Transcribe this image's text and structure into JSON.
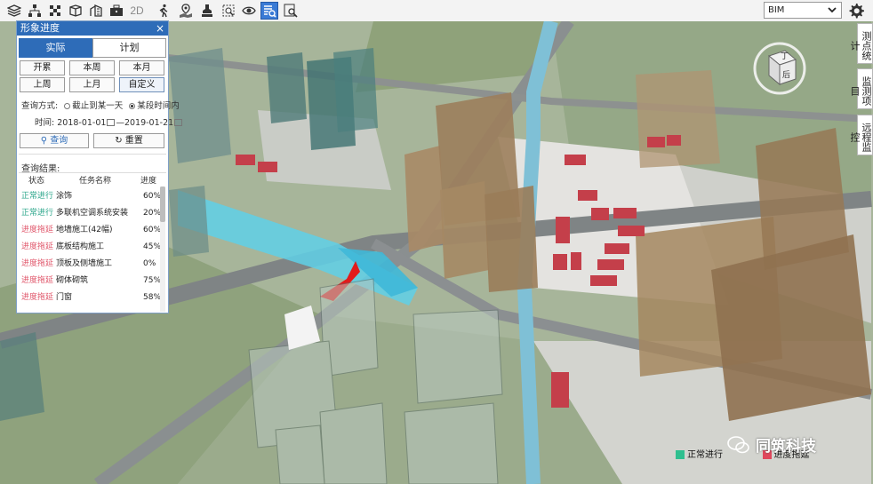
{
  "toolbar": {
    "icons": [
      "layers-icon",
      "tree-icon",
      "grid-icon",
      "box-icon",
      "building-icon",
      "briefcase-icon",
      "2d-icon",
      "walk-icon",
      "map-pin-icon",
      "stamp-icon",
      "measure-icon",
      "eye-icon",
      "progress-icon",
      "zoom-doc-icon"
    ],
    "label_2d": "2D",
    "bim_value": "BIM"
  },
  "side_tabs": [
    "测点统计",
    "监测项目",
    "远程监控"
  ],
  "compass": {
    "top_label": "丁",
    "face_label": "后"
  },
  "panel": {
    "title": "形象进度",
    "close": "×",
    "mode_tabs": [
      "实际",
      "计划"
    ],
    "range_buttons": [
      "开累",
      "本周",
      "本月",
      "上周",
      "上月",
      "自定义"
    ],
    "selected_range": "自定义",
    "query_mode_label": "查询方式:",
    "option_until": "截止到某一天",
    "option_period": "某段时间内",
    "time_label": "时间:",
    "date_from": "2018-01-01",
    "date_to": "2019-01-21",
    "query_button": "查询",
    "reset_button": "重置",
    "results_label": "查询结果:",
    "columns": [
      "状态",
      "任务名称",
      "进度"
    ],
    "rows": [
      {
        "status": "正常进行",
        "task": "涂饰",
        "progress": "60%",
        "kind": "normal"
      },
      {
        "status": "正常进行",
        "task": "多联机空调系统安装",
        "progress": "20%",
        "kind": "normal"
      },
      {
        "status": "进度拖延",
        "task": "地墙施工(42幅)",
        "progress": "60%",
        "kind": "delay"
      },
      {
        "status": "进度拖延",
        "task": "底板结构施工",
        "progress": "45%",
        "kind": "delay"
      },
      {
        "status": "进度拖延",
        "task": "顶板及侧墙施工",
        "progress": "0%",
        "kind": "delay"
      },
      {
        "status": "进度拖延",
        "task": "砌体砌筑",
        "progress": "75%",
        "kind": "delay"
      },
      {
        "status": "进度拖延",
        "task": "门窗",
        "progress": "58%",
        "kind": "delay"
      }
    ]
  },
  "legend": {
    "normal_label": "正常进行",
    "delay_label": "进度拖延",
    "normal_color": "#2fbf8f",
    "delay_color": "#e0465c"
  },
  "watermark": "同筑科技",
  "colors": {
    "accent": "#2e6cb8",
    "normal_text": "#2aa58a",
    "delay_text": "#e0576b"
  }
}
